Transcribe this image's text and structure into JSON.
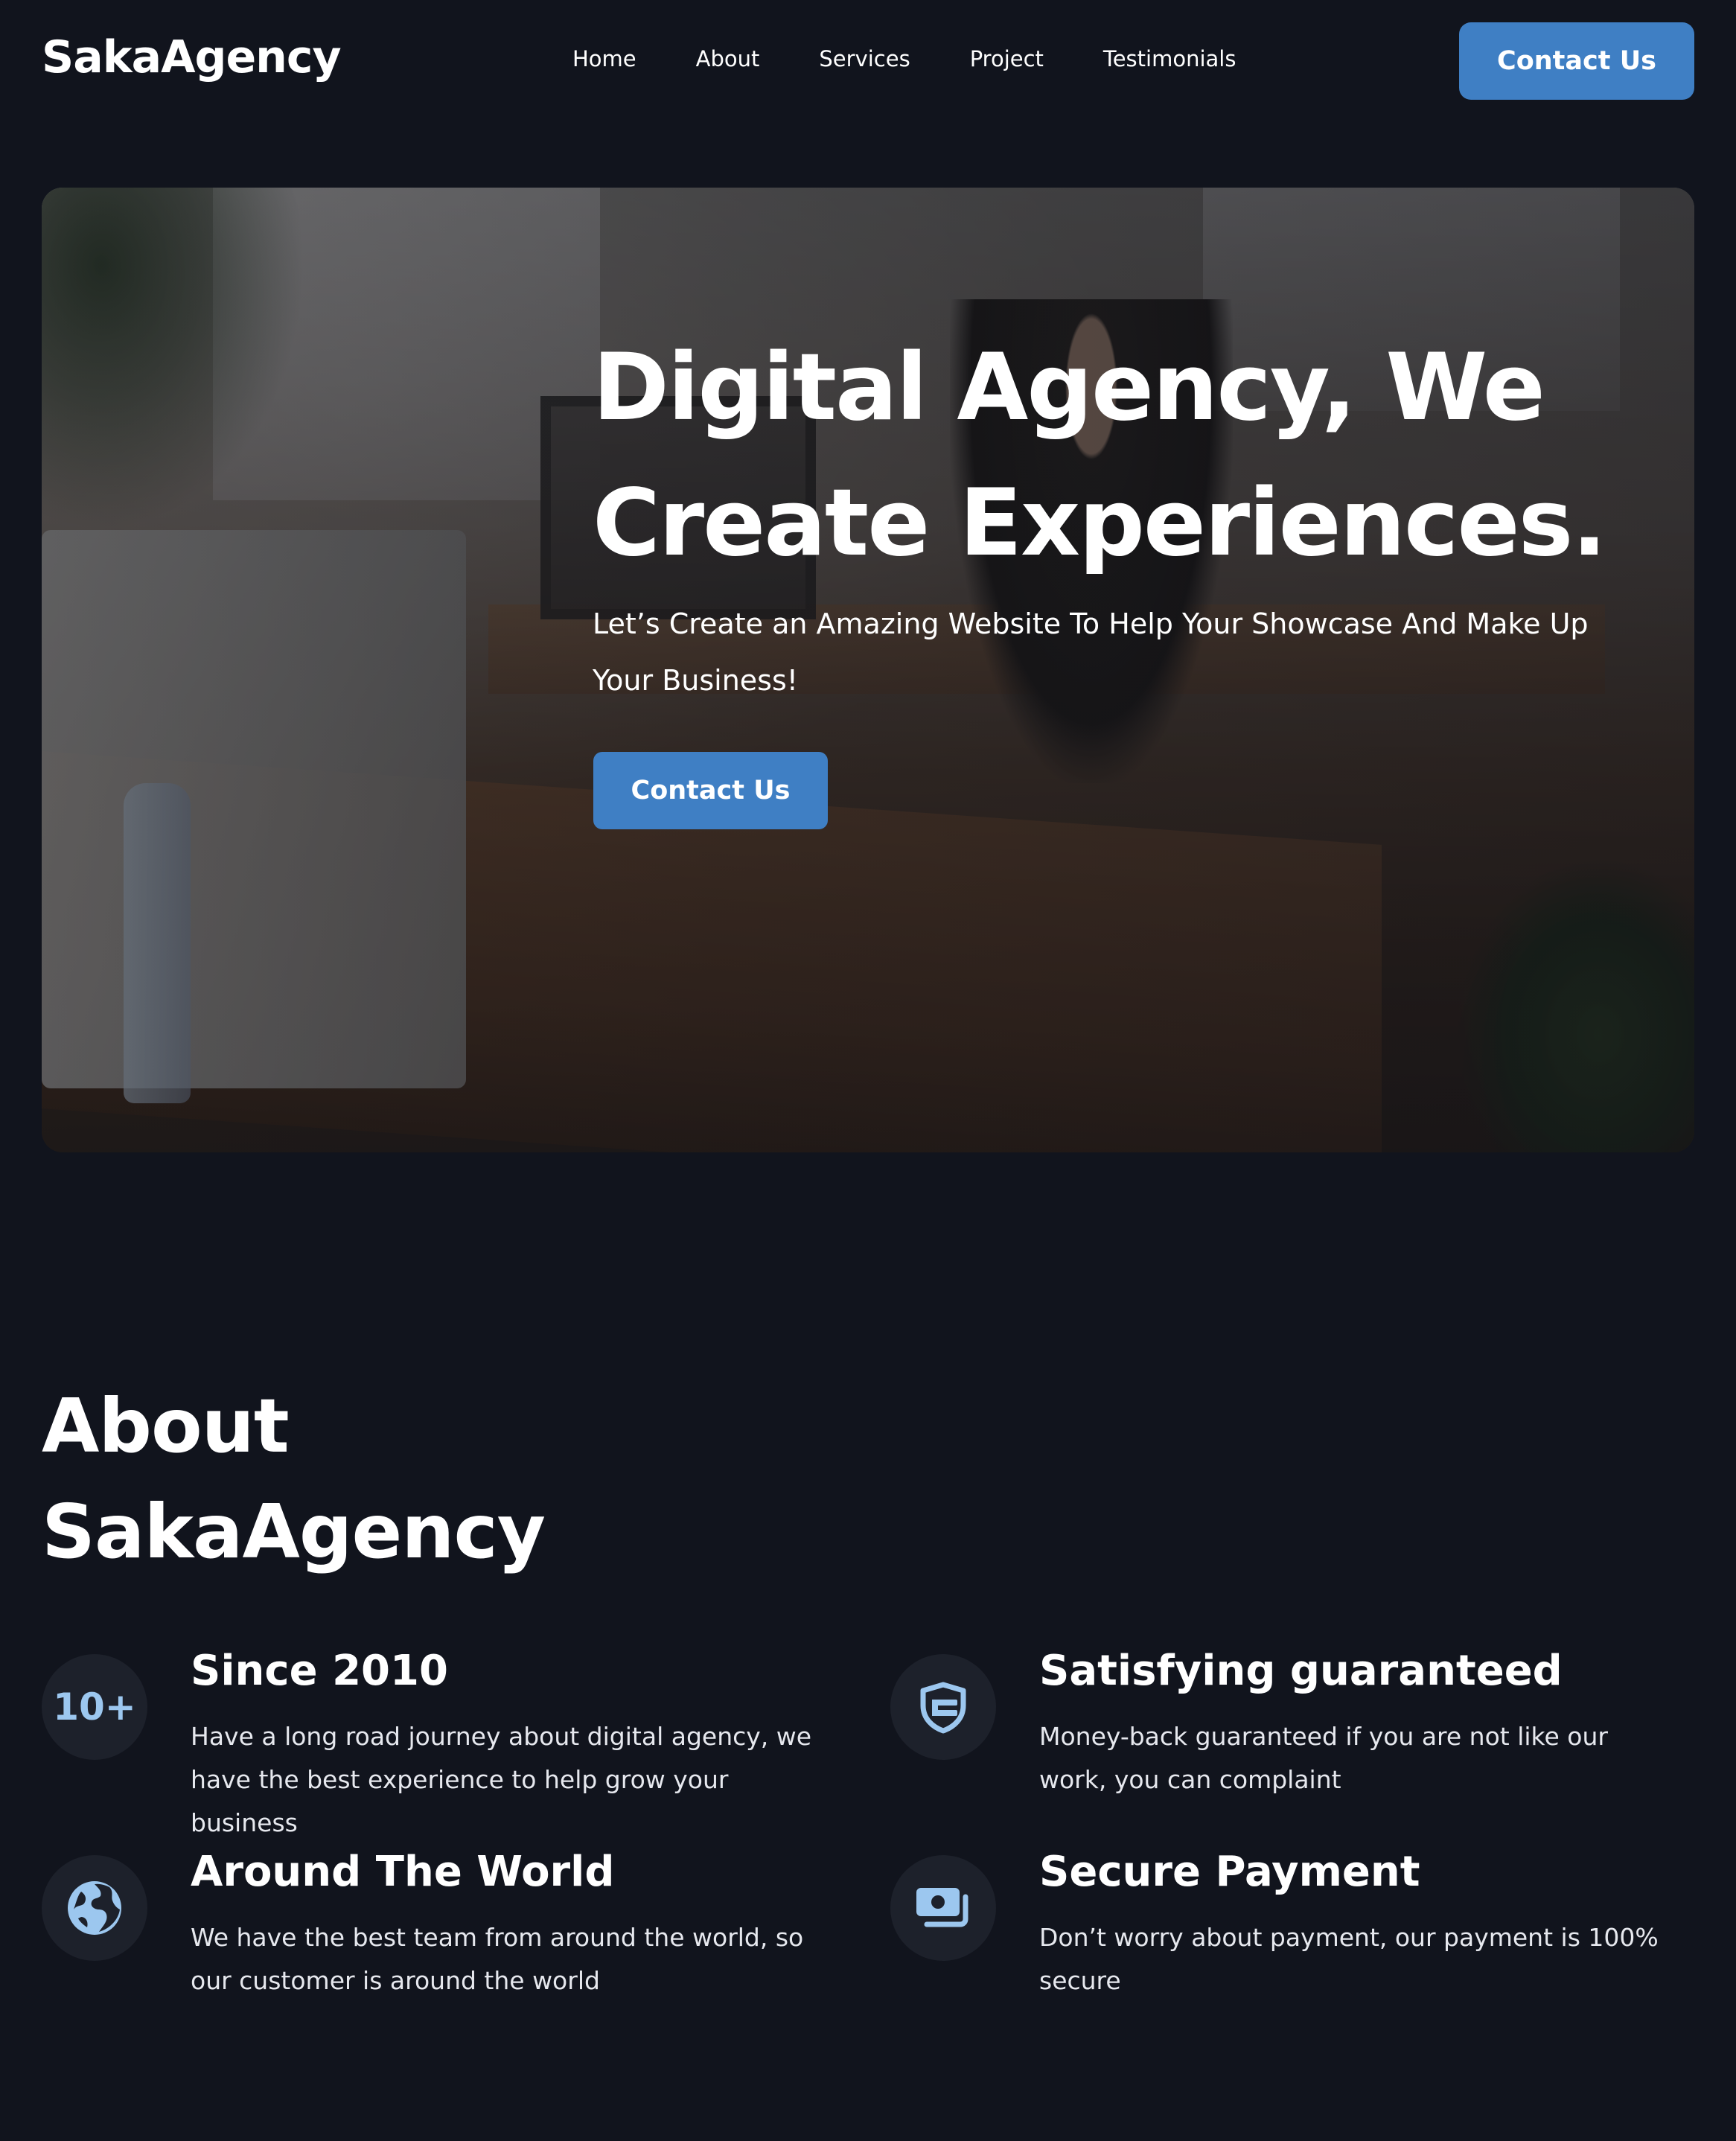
{
  "nav": {
    "logo": "SakaAgency",
    "links": [
      "Home",
      "About",
      "Services",
      "Project",
      "Testimonials"
    ],
    "cta": "Contact Us"
  },
  "hero": {
    "title": "Digital Agency, We\nCreate Experiences.",
    "subtitle": "Let’s Create an Amazing Website To Help Your Showcase And Make Up Your Business!",
    "cta": "Contact Us"
  },
  "about": {
    "title_line1": "About",
    "title_line2": "SakaAgency",
    "features": [
      {
        "icon": "10+",
        "icon_name": "ten-plus-badge",
        "title": "Since 2010",
        "desc": "Have a long road journey about digital agency, we have the best experience to help grow your business"
      },
      {
        "icon_name": "shield-check-icon",
        "title": "Satisfying guaranteed",
        "desc": "Money-back guaranteed if you are not like our work, you can complaint"
      },
      {
        "icon_name": "globe-icon",
        "title": "Around The World",
        "desc": "We have the best team from around the world, so our customer is around the world"
      },
      {
        "icon_name": "money-icon",
        "title": "Secure Payment",
        "desc": "Don’t worry about payment, our payment is 100% secure"
      }
    ]
  },
  "colors": {
    "background": "#11141d",
    "accent": "#3f7fc4",
    "icon_bg": "#1d212b",
    "icon_fg": "#9cc7ef"
  }
}
